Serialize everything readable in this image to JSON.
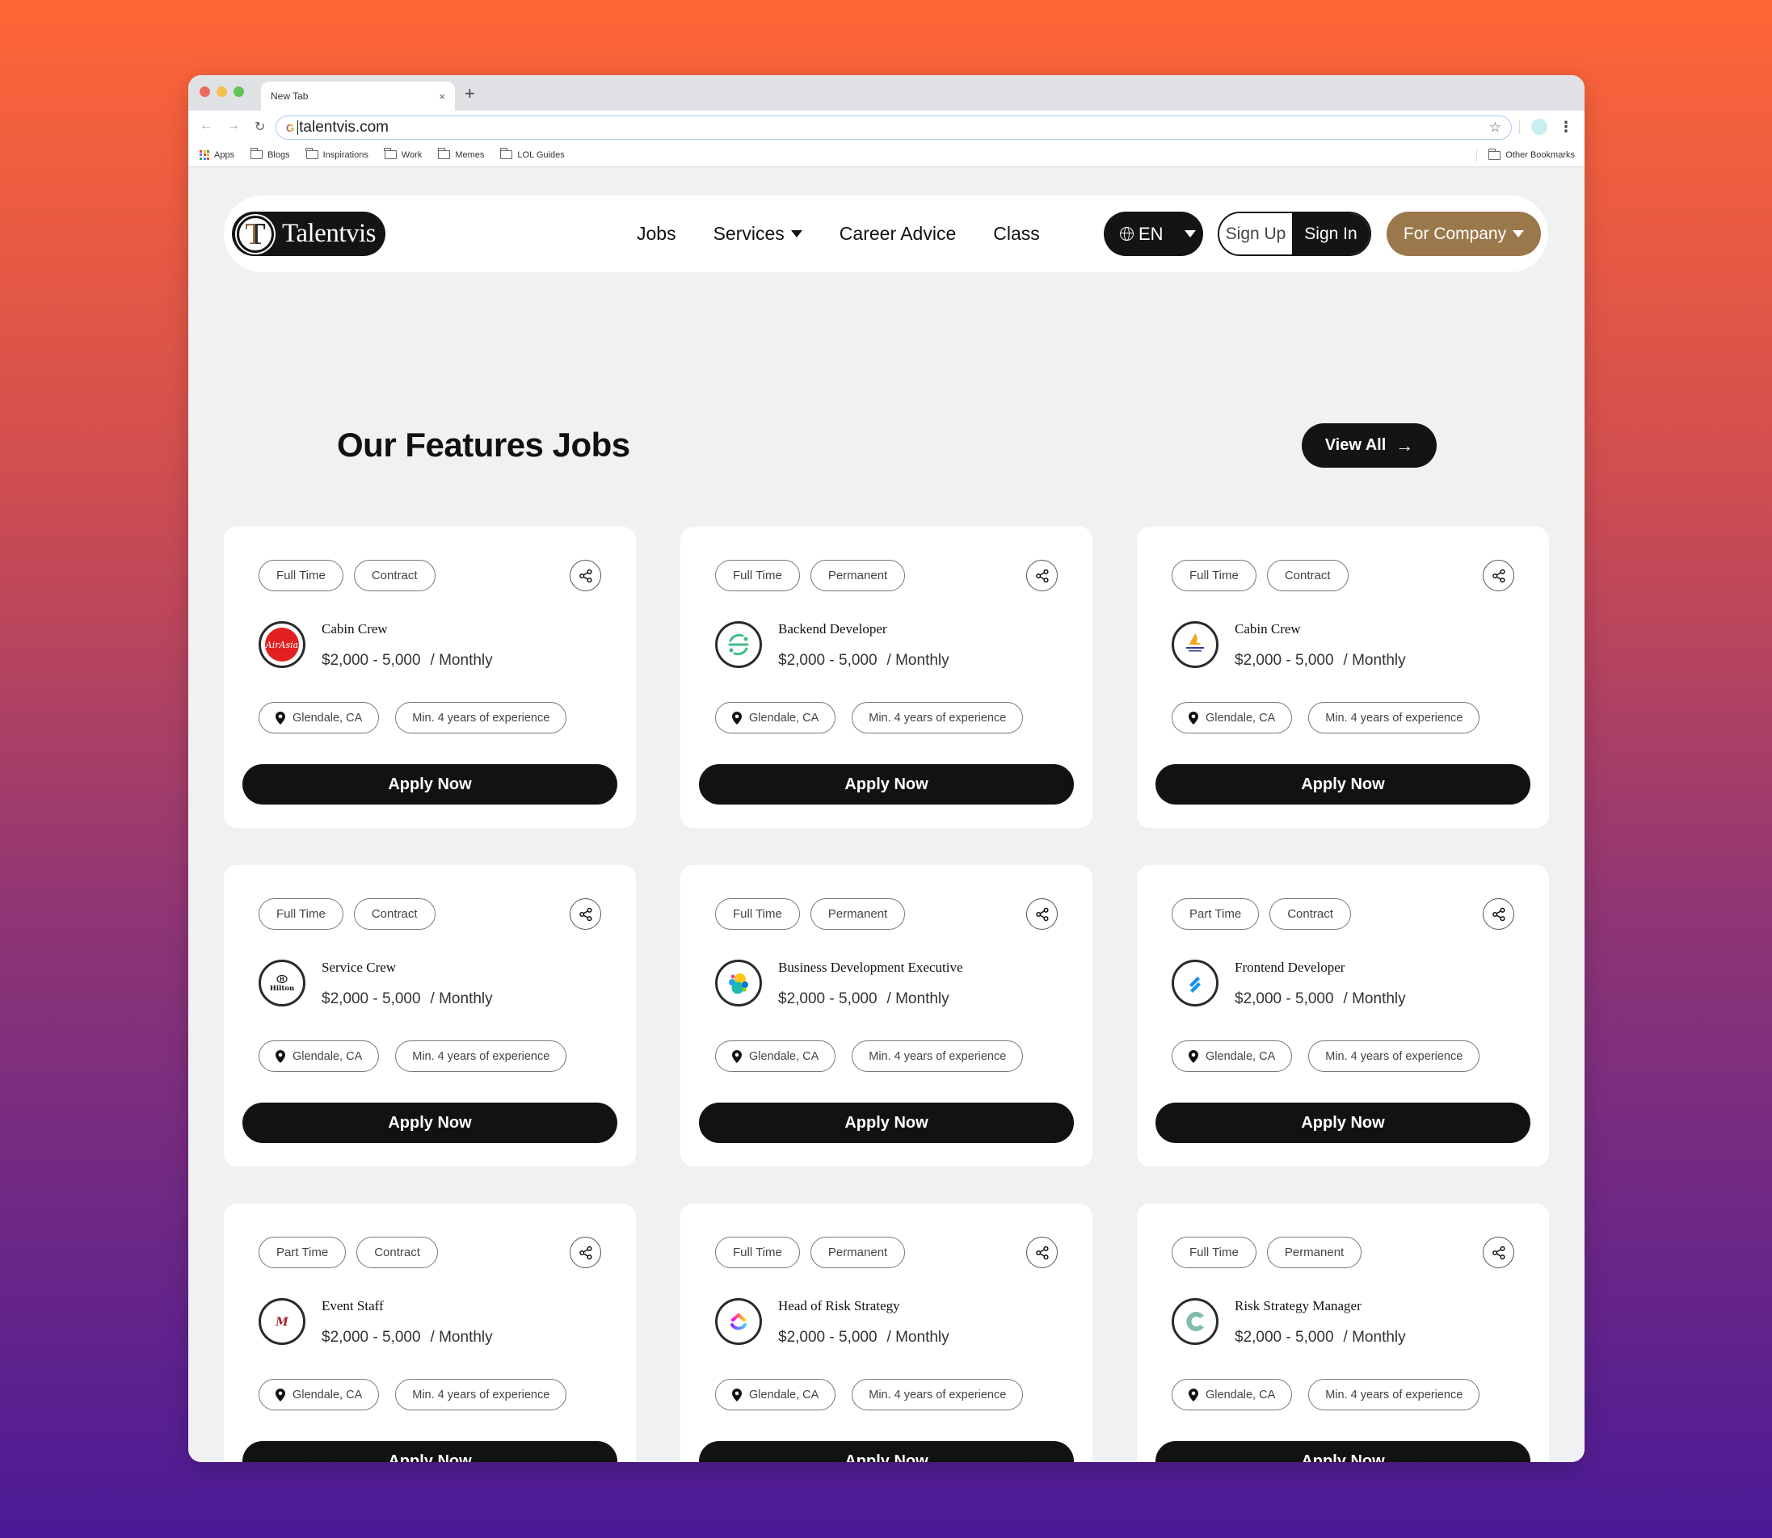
{
  "browser": {
    "tab_title": "New Tab",
    "tab_close": "×",
    "new_tab": "+",
    "back": "←",
    "forward": "→",
    "reload": "↻",
    "url": "talentvis.com",
    "google_g": "G",
    "star": "☆",
    "kebab": "⋮",
    "bookmarks": [
      "Apps",
      "Blogs",
      "Inspirations",
      "Work",
      "Memes",
      "LOL Guides"
    ],
    "other_bookmarks": "Other Bookmarks"
  },
  "nav": {
    "logo_mark": "T",
    "logo_text": "Talentvis",
    "menu": [
      {
        "label": "Jobs",
        "dropdown": false
      },
      {
        "label": "Services",
        "dropdown": true
      },
      {
        "label": "Career Advice",
        "dropdown": false
      },
      {
        "label": "Class",
        "dropdown": false
      }
    ],
    "language": "EN",
    "sign_up": "Sign Up",
    "sign_in": "Sign In",
    "for_company": "For Company"
  },
  "section": {
    "title": "Our Features Jobs",
    "view_all": "View All",
    "view_all_arrow": "→"
  },
  "colors": {
    "accent_gold": "#9b784b",
    "dark": "#141414",
    "page_bg": "#f0f1f3"
  },
  "jobs": [
    {
      "tags": [
        "Full Time",
        "Contract"
      ],
      "title": "Cabin Crew",
      "company_logo": "airasia-logo",
      "salary": "$2,000 - 5,000",
      "period": "/ Monthly",
      "location": "Glendale, CA",
      "experience": "Min. 4 years of experience",
      "apply": "Apply Now"
    },
    {
      "tags": [
        "Full Time",
        "Permanent"
      ],
      "title": "Backend Developer",
      "company_logo": "sentry-style-green-logo",
      "salary": "$2,000 - 5,000",
      "period": "/ Monthly",
      "location": "Glendale, CA",
      "experience": "Min. 4 years of experience",
      "apply": "Apply Now"
    },
    {
      "tags": [
        "Full Time",
        "Contract"
      ],
      "title": "Cabin Crew",
      "company_logo": "singapore-airlines-logo",
      "salary": "$2,000 - 5,000",
      "period": "/ Monthly",
      "location": "Glendale, CA",
      "experience": "Min. 4 years of experience",
      "apply": "Apply Now"
    },
    {
      "tags": [
        "Full Time",
        "Contract"
      ],
      "title": "Service Crew",
      "company_logo": "hilton-logo",
      "salary": "$2,000 - 5,000",
      "period": "/ Monthly",
      "location": "Glendale, CA",
      "experience": "Min. 4 years of experience",
      "apply": "Apply Now"
    },
    {
      "tags": [
        "Full Time",
        "Permanent"
      ],
      "title": "Business Development Executive",
      "company_logo": "elastic-logo",
      "salary": "$2,000 - 5,000",
      "period": "/ Monthly",
      "location": "Glendale, CA",
      "experience": "Min. 4 years of experience",
      "apply": "Apply Now"
    },
    {
      "tags": [
        "Part Time",
        "Contract"
      ],
      "title": "Frontend Developer",
      "company_logo": "helpscout-logo",
      "salary": "$2,000 - 5,000",
      "period": "/ Monthly",
      "location": "Glendale, CA",
      "experience": "Min. 4 years of experience",
      "apply": "Apply Now"
    },
    {
      "tags": [
        "Part Time",
        "Contract"
      ],
      "title": "Event Staff",
      "company_logo": "marriott-logo",
      "salary": "$2,000 - 5,000",
      "period": "/ Monthly",
      "location": "Glendale, CA",
      "experience": "Min. 4 years of experience",
      "apply": "Apply Now"
    },
    {
      "tags": [
        "Full Time",
        "Permanent"
      ],
      "title": "Head of Risk Strategy",
      "company_logo": "clickup-logo",
      "salary": "$2,000 - 5,000",
      "period": "/ Monthly",
      "location": "Glendale, CA",
      "experience": "Min. 4 years of experience",
      "apply": "Apply Now"
    },
    {
      "tags": [
        "Full Time",
        "Permanent"
      ],
      "title": "Risk Strategy Manager",
      "company_logo": "green-c-logo",
      "salary": "$2,000 - 5,000",
      "period": "/ Monthly",
      "location": "Glendale, CA",
      "experience": "Min. 4 years of experience",
      "apply": "Apply Now"
    }
  ]
}
